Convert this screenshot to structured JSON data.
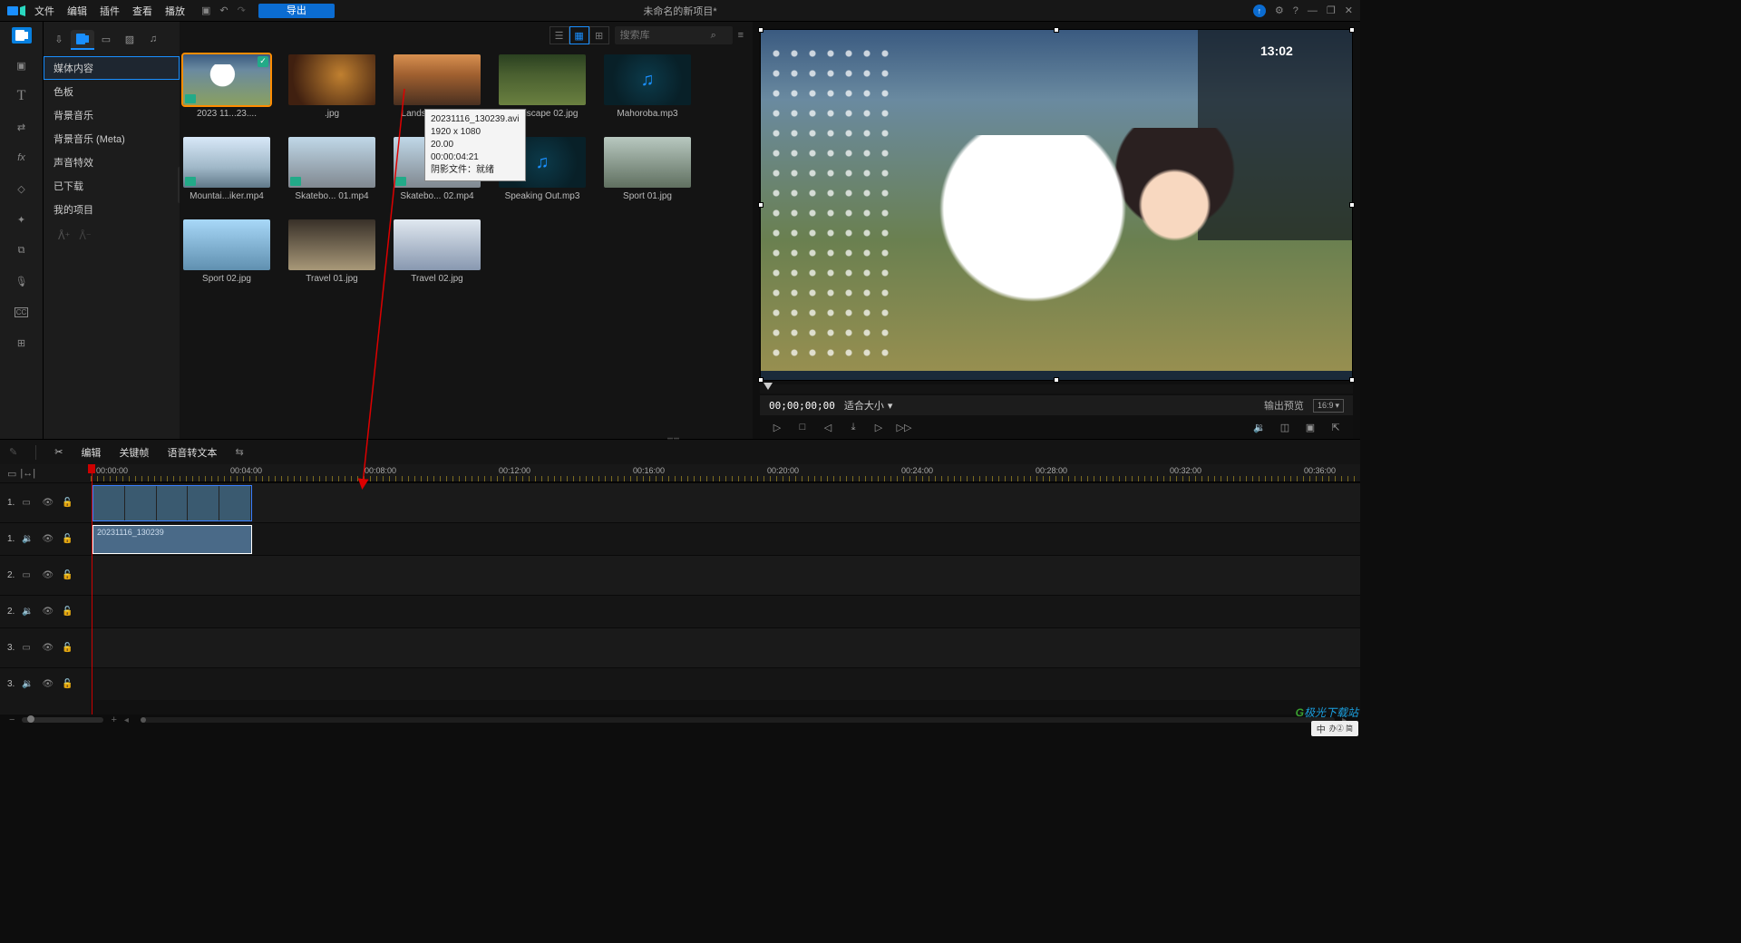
{
  "menubar": {
    "file": "文件",
    "edit": "编辑",
    "plugin": "插件",
    "view": "查看",
    "play": "播放"
  },
  "export_label": "导出",
  "window_title": "未命名的新项目*",
  "sidebar": {
    "items": [
      "媒体内容",
      "色板",
      "背景音乐",
      "背景音乐 (Meta)",
      "声音特效",
      "已下载",
      "我的项目"
    ],
    "selected": 0
  },
  "search": {
    "placeholder": "搜索库"
  },
  "media": [
    {
      "label": "2023 11...23....",
      "type": "video",
      "th": "anime",
      "checked": true
    },
    {
      "label": ".jpg",
      "type": "image",
      "th": "food"
    },
    {
      "label": "Landscape 01.jpg",
      "type": "image",
      "th": "land1"
    },
    {
      "label": "Landscape 02.jpg",
      "type": "image",
      "th": "land2"
    },
    {
      "label": "Mahoroba.mp3",
      "type": "audio"
    },
    {
      "label": "Mountai...iker.mp4",
      "type": "video",
      "th": "bike"
    },
    {
      "label": "Skatebo... 01.mp4",
      "type": "video",
      "th": "skate"
    },
    {
      "label": "Skatebo... 02.mp4",
      "type": "video",
      "th": "skate"
    },
    {
      "label": "Speaking Out.mp3",
      "type": "audio"
    },
    {
      "label": "Sport 01.jpg",
      "type": "image",
      "th": "sport"
    },
    {
      "label": "Sport 02.jpg",
      "type": "image",
      "th": "sport2"
    },
    {
      "label": "Travel 01.jpg",
      "type": "image",
      "th": "travel"
    },
    {
      "label": "Travel 02.jpg",
      "type": "image",
      "th": "travel2"
    }
  ],
  "tooltip": {
    "name": "20231116_130239.avi",
    "res": "1920 x 1080",
    "fps": "20.00",
    "dur": "00:00:04:21",
    "shadow": "阴影文件：就绪"
  },
  "preview": {
    "time": "00;00;00;00",
    "fit": "适合大小",
    "output": "输出预览",
    "aspect": "16:9",
    "clock": "13:02"
  },
  "tl_tabs": {
    "edit": "编辑",
    "keyframe": "关键帧",
    "stt": "语音转文本"
  },
  "ruler": [
    "00:00:00",
    "00:04:00",
    "00:08:00",
    "00:12:00",
    "00:16:00",
    "00:20:00",
    "00:24:00",
    "00:28:00",
    "00:32:00",
    "00:36:00"
  ],
  "tracks": [
    {
      "name": "1.",
      "type": "video"
    },
    {
      "name": "1.",
      "type": "audio"
    },
    {
      "name": "2.",
      "type": "video"
    },
    {
      "name": "2.",
      "type": "audio"
    },
    {
      "name": "3.",
      "type": "video"
    },
    {
      "name": "3.",
      "type": "audio"
    }
  ],
  "audio_clip_label": "20231116_130239",
  "watermark": "极光下载站",
  "ime": {
    "label": "中",
    "sub": "办② 简"
  }
}
